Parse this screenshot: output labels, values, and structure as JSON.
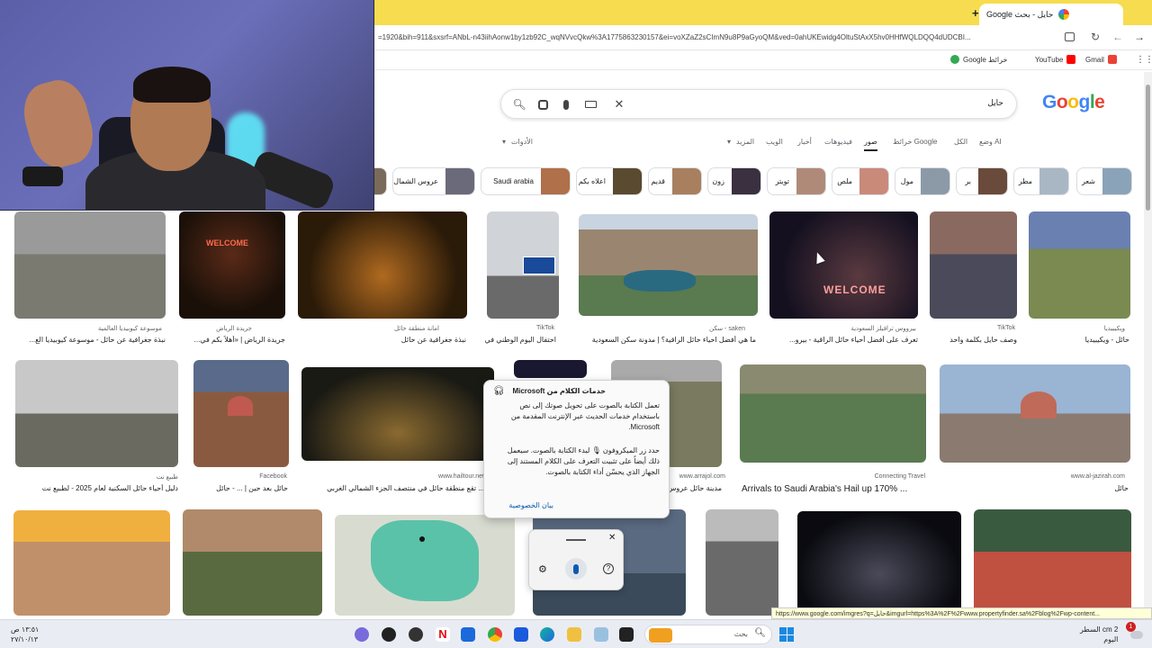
{
  "browser": {
    "tab_title": "حايل - بحث Google",
    "url": "=1920&bih=911&sxsrf=ANbL-n43iihAonw1by1zb92C_wqNVvcQkw%3A1775863230157&ei=voXZaZ2sCImN9u8P9aGyoQM&ved=0ahUKEwidg4OltuStAxX5hv0HHfWQLDQQ4dUDCBI...",
    "bookmarks": [
      {
        "label": "Google خرائط",
        "icon": "google-maps-icon",
        "color": "#34a853"
      },
      {
        "label": "YouTube",
        "icon": "youtube-icon",
        "color": "#ff0000"
      },
      {
        "label": "Gmail",
        "icon": "gmail-icon",
        "color": "#ea4335"
      }
    ]
  },
  "search": {
    "query": "حايل",
    "logo": "Google"
  },
  "filters": [
    {
      "label": "وضع AI",
      "active": false
    },
    {
      "label": "الكل",
      "active": false
    },
    {
      "label": "خرائط Google",
      "active": false
    },
    {
      "label": "صور",
      "active": true
    },
    {
      "label": "فيديوهات",
      "active": false
    },
    {
      "label": "أخبار",
      "active": false
    },
    {
      "label": "الويب",
      "active": false
    },
    {
      "label": "المزيد",
      "active": false
    },
    {
      "label": "الأدوات",
      "active": false
    }
  ],
  "chips": [
    {
      "label": "شعر",
      "color": "#8aa3b8"
    },
    {
      "label": "مطر",
      "color": "#a9b7c4"
    },
    {
      "label": "بر",
      "color": "#6a4a3a"
    },
    {
      "label": "مول",
      "color": "#8c9aa8"
    },
    {
      "label": "ملص",
      "color": "#c98a7a"
    },
    {
      "label": "تويتر",
      "color": "#b08a78"
    },
    {
      "label": "زون",
      "color": "#3a3040"
    },
    {
      "label": "قديم",
      "color": "#a88060"
    },
    {
      "label": "اعلاه بكم",
      "color": "#5a4a30"
    },
    {
      "label": "Saudi arabia",
      "color": "#b0704a"
    },
    {
      "label": "عروس الشمال",
      "color": "#6a6a7a"
    }
  ],
  "results_row1": [
    {
      "source": "ويكيبيديا",
      "title": "حائل - ويكيبيديا",
      "color": "#7a8a50"
    },
    {
      "source": "TikTok",
      "title": "وصف حايل بكلمة واحد",
      "color": "#5a4a5a"
    },
    {
      "source": "بيرووس ترافيلز السعودية",
      "title": "تعرف على أفضل أحياء حائل الراقية - بيرو...",
      "color": "#241a30"
    },
    {
      "source": "saken - سكن",
      "title": "ما هي أفضل احياء حائل الراقية؟ | مدونة سكن السعودية",
      "color": "#8a7a60"
    },
    {
      "source": "TikTok",
      "title": "احتفال اليوم الوطني في...",
      "color": "#c0c4c8"
    },
    {
      "source": "امانة منطقة حائل",
      "title": "نبذة جغرافية عن حائل",
      "color": "#3a2410"
    },
    {
      "source": "جريدة الرياض",
      "title": "جريدة الرياض | «أهلاً بكم في...",
      "color": "#3a2a18"
    },
    {
      "source": "موسوعة كيوبيديا العالمية",
      "title": "نبذة جغرافية عن حائل - موسوعة كيوبيديا الع...",
      "color": "#8a8a8a"
    }
  ],
  "results_row2": [
    {
      "source": "www.al-jazirah.com",
      "title": "حائل",
      "color": "#8aa4c4"
    },
    {
      "source": "Connecting Travel",
      "title": "Arrivals to Saudi Arabia's Hail up 170% ...",
      "color": "#6a7a50"
    },
    {
      "source": "www.arrajol.com",
      "title": "مدينة حائل عروس...",
      "color": "#8a8470"
    },
    {
      "source": "www.hailtour.net",
      "title": "... تقع منطقة حائل في منتصف الجزء الشمالي الغربي",
      "color": "#2a2a20"
    },
    {
      "source": "Facebook",
      "title": "حائل بعد حين | ... - حائل",
      "color": "#9a5040"
    },
    {
      "source": "ظبيع نت",
      "title": "دليل أحياء حائل السكنية لعام 2025 - لطبيع نت",
      "color": "#a8a8a0"
    }
  ],
  "popup": {
    "title": "خدمات الكلام من Microsoft",
    "body1": "تعمل الكتابة بالصوت على تحويل صوتك إلى نص باستخدام خدمات الحديث عبر الإنترنت المقدمة من Microsoft.",
    "body2": "حدد زر الميكروفون 🎙 لبدء الكتابة بالصوت. سيعمل ذلك أيضاً على تثبيت التعرف على الكلام المستند إلى الجهاز الذي يحسّن أداء الكتابة بالصوت.",
    "privacy_link": "بيان الخصوصية"
  },
  "status_url": "https://www.google.com/imgres?q=حايل&imgurl=https%3A%2F%2Fwww.propertyfinder.sa%2Fblog%2Fwp-content...",
  "taskbar": {
    "search_placeholder": "بحث",
    "weather": "2 cm السطر",
    "weather_sub": "اليوم",
    "clock_time": "١٣:٥١ ص",
    "clock_date": "٢٧/١٠/١٣",
    "notification_count": "1"
  }
}
